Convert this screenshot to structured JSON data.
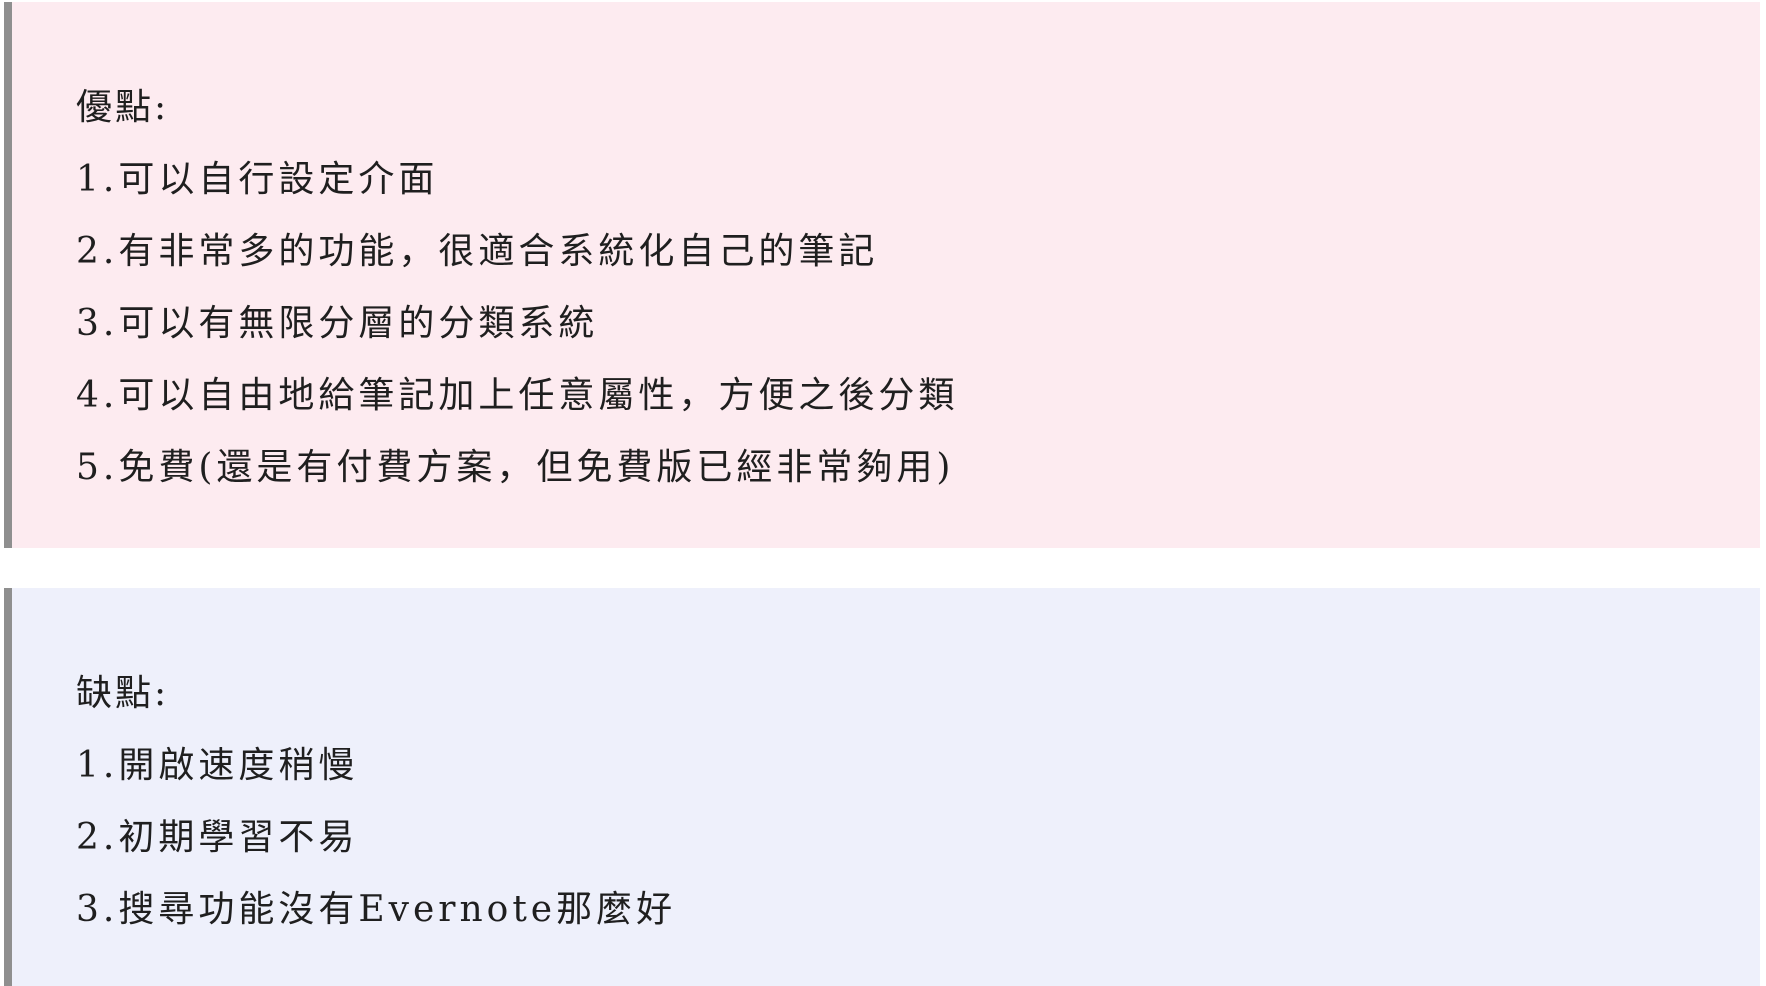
{
  "pros": {
    "heading": "優點:",
    "items": [
      "1.可以自行設定介面",
      "2.有非常多的功能，很適合系統化自己的筆記",
      "3.可以有無限分層的分類系統",
      "4.可以自由地給筆記加上任意屬性，方便之後分類",
      "5.免費(還是有付費方案，但免費版已經非常夠用)"
    ]
  },
  "cons": {
    "heading": "缺點:",
    "items": [
      "1.開啟速度稍慢",
      "2.初期學習不易",
      "3.搜尋功能沒有Evernote那麼好"
    ]
  },
  "colors": {
    "pros_background": "#fdebf0",
    "cons_background": "#eef0fb",
    "border": "#8f8f8f"
  }
}
